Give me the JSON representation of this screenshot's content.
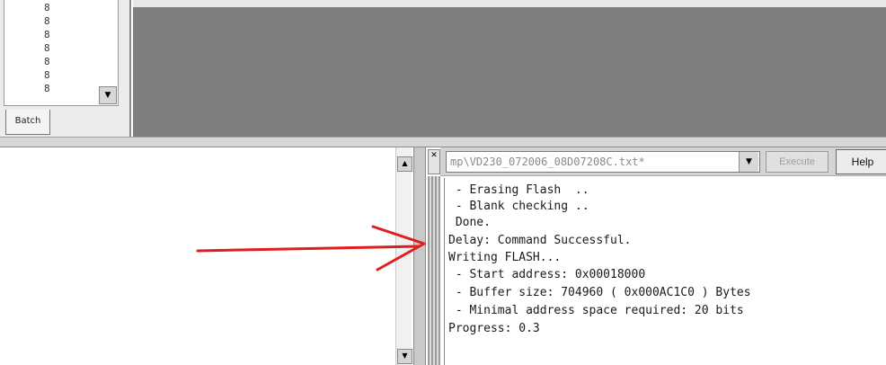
{
  "list_panel": {
    "items": [
      "8",
      "8",
      "8",
      "8",
      "8",
      "8",
      "8"
    ],
    "tab_label": "Batch",
    "scroll_down_glyph": "▼"
  },
  "bottom_left": {
    "scroll_up_glyph": "▲",
    "scroll_down_glyph": "▼"
  },
  "close_glyph": "✕",
  "toolbar": {
    "script_path": "mp\\VD230_072006_08D07208C.txt*",
    "combo_arrow": "▼",
    "execute_label": "Execute",
    "help_label": "Help"
  },
  "console": {
    "lines": [
      " - Erasing Flash  ..",
      " - Blank checking ..",
      " Done.",
      "Delay: Command Successful.",
      "Writing FLASH...",
      " - Start address: 0x00018000",
      " - Buffer size: 704960 ( 0x000AC1C0 ) Bytes",
      " - Minimal address space required: 20 bits",
      "Progress: 0.3"
    ]
  },
  "colors": {
    "workspace_gray": "#7e7e80",
    "annotation_red": "#e11d1d"
  },
  "icons": {
    "annotation": "red-arrow-icon"
  }
}
